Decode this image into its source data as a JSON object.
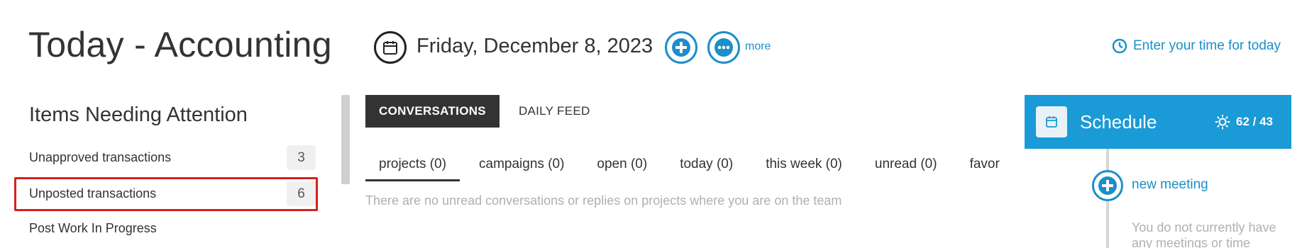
{
  "header": {
    "title": "Today - Accounting",
    "date": "Friday, December 8, 2023",
    "more_label": "more",
    "enter_time_label": "Enter your time for today"
  },
  "attention": {
    "heading": "Items Needing Attention",
    "items": [
      {
        "label": "Unapproved transactions",
        "count": "3"
      },
      {
        "label": "Unposted transactions",
        "count": "6"
      },
      {
        "label": "Post Work In Progress",
        "count": ""
      }
    ]
  },
  "feed": {
    "tabs": [
      {
        "label": "CONVERSATIONS",
        "active": true
      },
      {
        "label": "DAILY FEED",
        "active": false
      }
    ],
    "sub_tabs": [
      {
        "label": "projects (0)",
        "active": true
      },
      {
        "label": "campaigns (0)",
        "active": false
      },
      {
        "label": "open (0)",
        "active": false
      },
      {
        "label": "today (0)",
        "active": false
      },
      {
        "label": "this week (0)",
        "active": false
      },
      {
        "label": "unread (0)",
        "active": false
      },
      {
        "label": "favor",
        "active": false
      }
    ],
    "empty_message": "There are no unread conversations or replies on projects where you are on the team"
  },
  "schedule": {
    "title": "Schedule",
    "weather": "62 / 43",
    "new_meeting_label": "new meeting",
    "no_meetings_text": "You do not currently have any meetings or time"
  },
  "colors": {
    "accent": "#1a9ad6",
    "link": "#1a8fc9",
    "highlight": "#d42020",
    "active_tab_bg": "#333333"
  },
  "icons": {
    "calendar": "calendar-icon",
    "add": "plus-icon",
    "more": "ellipsis-icon",
    "clock": "clock-icon",
    "sun": "sun-icon"
  }
}
